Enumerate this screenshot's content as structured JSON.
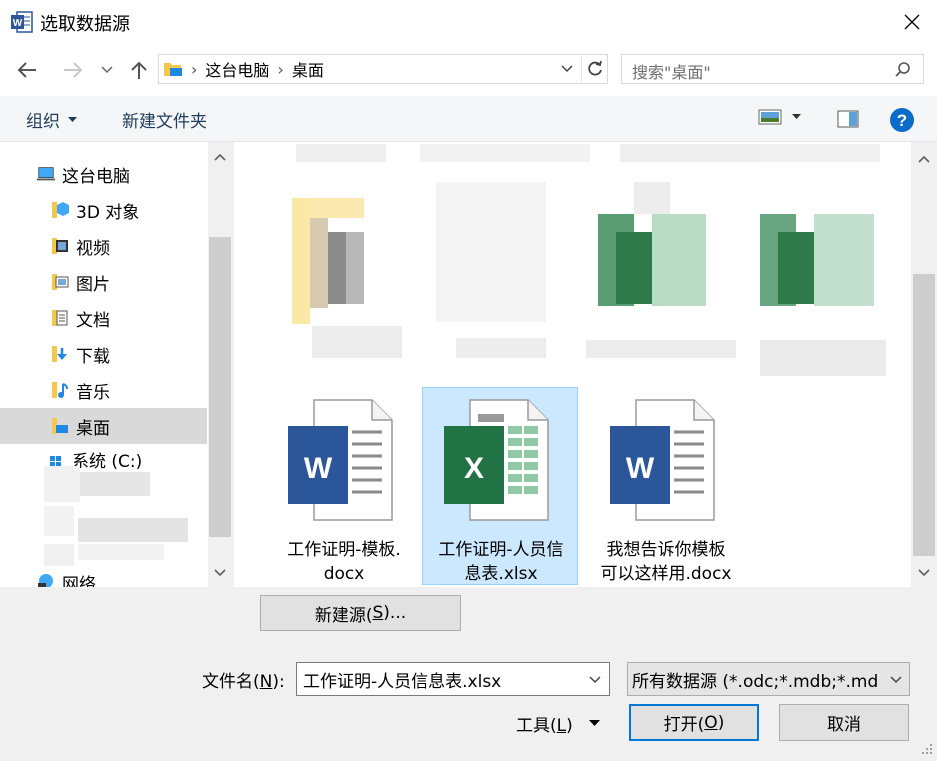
{
  "window": {
    "title": "选取数据源"
  },
  "address": {
    "root": "这台电脑",
    "current": "桌面"
  },
  "search": {
    "placeholder": "搜索\"桌面\""
  },
  "toolbar": {
    "organize": "组织",
    "new_folder": "新建文件夹"
  },
  "sidebar": {
    "items": [
      {
        "label": "这台电脑",
        "icon": "computer-icon"
      },
      {
        "label": "3D 对象",
        "icon": "3d-objects-folder-icon"
      },
      {
        "label": "视频",
        "icon": "videos-folder-icon"
      },
      {
        "label": "图片",
        "icon": "pictures-folder-icon"
      },
      {
        "label": "文档",
        "icon": "documents-folder-icon"
      },
      {
        "label": "下载",
        "icon": "downloads-folder-icon"
      },
      {
        "label": "音乐",
        "icon": "music-folder-icon"
      },
      {
        "label": "桌面",
        "icon": "desktop-folder-icon",
        "selected": true
      },
      {
        "label": "系统 (C:)",
        "icon": "drive-icon"
      },
      {
        "label": "网络",
        "icon": "network-icon"
      }
    ]
  },
  "files": [
    {
      "name": "工作证明-模板.docx",
      "line1": "工作证明-模板.",
      "line2": "docx",
      "type": "word",
      "icon": "word-document-icon"
    },
    {
      "name": "工作证明-人员信息表.xlsx",
      "line1": "工作证明-人员信",
      "line2": "息表.xlsx",
      "type": "excel",
      "icon": "excel-document-icon",
      "selected": true
    },
    {
      "name": "我想告诉你模板可以这样用.docx",
      "line1": "我想告诉你模板",
      "line2": "可以这样用.docx",
      "type": "word",
      "icon": "word-document-icon"
    }
  ],
  "buttons": {
    "new_source_prefix": "新建源(",
    "new_source_key": "S",
    "new_source_suffix": ")...",
    "tools_prefix": "工具(",
    "tools_key": "L",
    "tools_suffix": ")",
    "open_prefix": "打开(",
    "open_key": "O",
    "open_suffix": ")",
    "cancel": "取消"
  },
  "filename": {
    "label_prefix": "文件名(",
    "label_key": "N",
    "label_suffix": "):",
    "value": "工作证明-人员信息表.xlsx"
  },
  "filetype": {
    "value": "所有数据源 (*.odc;*.mdb;*.md"
  },
  "colors": {
    "accent": "#0078d7",
    "word_blue": "#2b579a",
    "excel_green": "#217346",
    "selection": "#cce8ff"
  }
}
